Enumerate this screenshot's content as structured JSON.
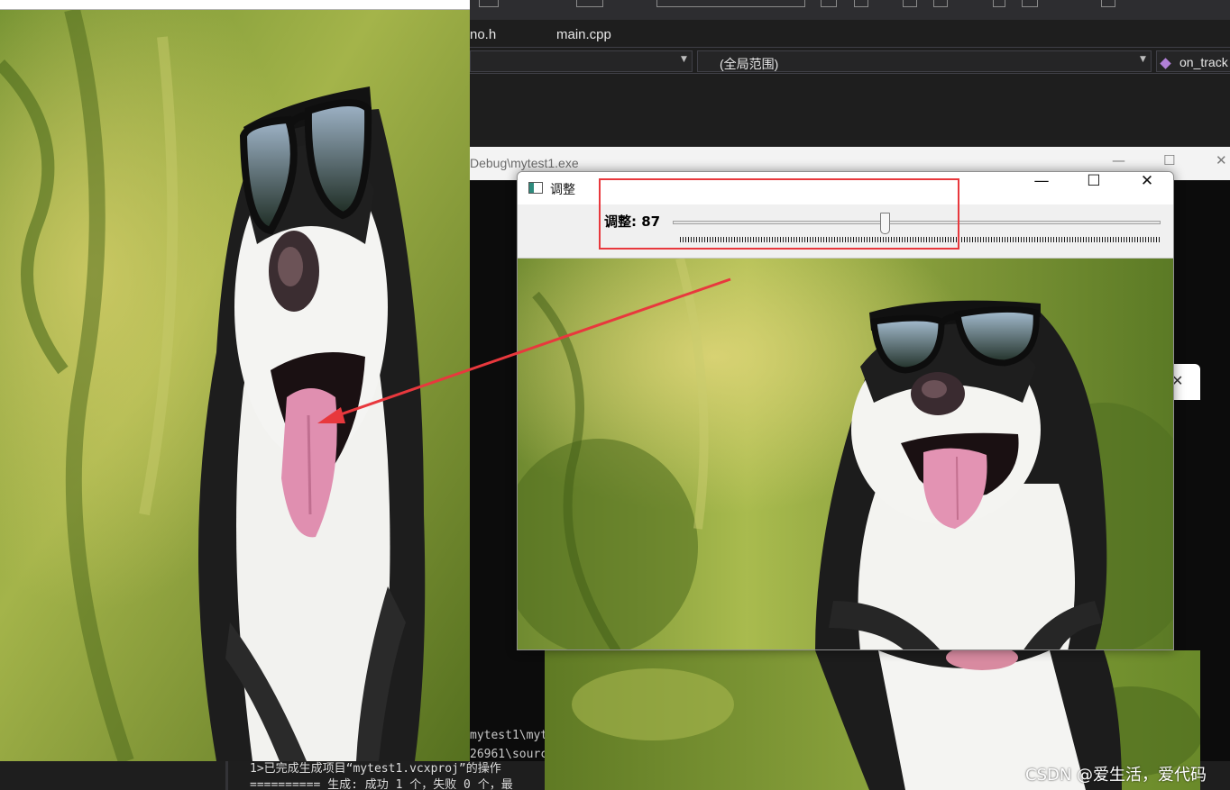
{
  "ide": {
    "file_tabs": [
      "no.h",
      "main.cpp"
    ],
    "scope_dropdown": "(全局范围)",
    "member_dropdown": "on_track"
  },
  "console_window": {
    "title": "Debug\\mytest1.exe",
    "lines": [
      "mytest1\\myt",
      "26961\\sourc"
    ]
  },
  "output_pane": {
    "lines": [
      "1>已完成生成项目“mytest1.vcxproj”的操作",
      "========== 生成: 成功 1 个，失败 0 个，最"
    ]
  },
  "trackbar_window": {
    "title": "调整",
    "trackbar_label": "调整: 87",
    "trackbar_value": 87,
    "trackbar_max": 200,
    "minimize_glyph": "—",
    "maximize_glyph": "☐",
    "close_glyph": "✕"
  },
  "second_window": {
    "close_glyph": "✕"
  },
  "watermark": "CSDN @爱生活，爱代码",
  "colors": {
    "annotation_red": "#e8383d",
    "ide_bg": "#1e1e1e",
    "console_bg": "#0c0c0c"
  },
  "icons": [
    "app-window-icon",
    "minimize-icon",
    "maximize-icon",
    "close-icon",
    "class-member-icon",
    "dropdown-caret-icon"
  ]
}
